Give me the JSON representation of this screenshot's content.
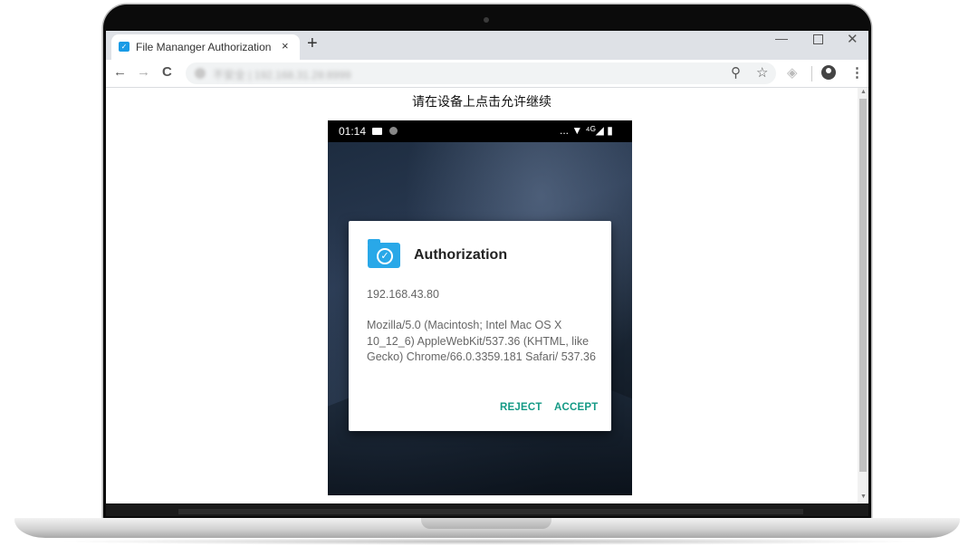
{
  "browser": {
    "tab": {
      "title": "File Mananger Authorization",
      "close": "×"
    },
    "new_tab": "+",
    "window_controls": {
      "minimize": "—",
      "close": "✕"
    },
    "nav": {
      "back": "←",
      "forward": "→",
      "reload": "C"
    },
    "url": "不安全 | 192.168.31.28:8999",
    "icons": {
      "zoom": "zoom-icon",
      "star": "star-icon",
      "extension": "tag-icon",
      "profile": "profile-icon",
      "menu": "⋮"
    },
    "star_glyph": "☆",
    "zoom_glyph": "⚲"
  },
  "page": {
    "heading": "请在设备上点击允许继续"
  },
  "phone": {
    "status_time": "01:14",
    "status_right": "... ▼ ⁴ᴳ◢ ▮",
    "dialog": {
      "title": "Authorization",
      "ip": "192.168.43.80",
      "user_agent": "Mozilla/5.0 (Macintosh; Intel Mac OS X 10_12_6) AppleWebKit/537.36 (KHTML, like Gecko) Chrome/66.0.3359.181 Safari/ 537.36",
      "reject_label": "REJECT",
      "accept_label": "ACCEPT",
      "accent_color": "#159a86",
      "icon_color": "#29a8e8"
    }
  }
}
